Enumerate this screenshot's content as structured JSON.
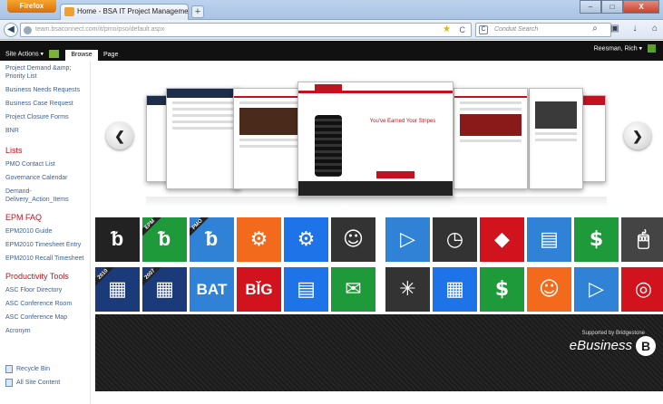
{
  "browser": {
    "menu_button": "Firefox",
    "tab_title": "Home - BSA IT Project Management Off...",
    "new_tab": "+",
    "window_min": "–",
    "window_max": "□",
    "window_close": "X",
    "url": "team.bsaconnect.com/it/pmo/pso/default.aspx",
    "search_placeholder": "Conduit Search",
    "search_engine_label": "C"
  },
  "ribbon": {
    "site_actions": "Site Actions ▾",
    "tabs": [
      "Browse",
      "Page"
    ],
    "user": "Reesman, Rich ▾"
  },
  "leftnav": {
    "items_top": [
      "Project Demand &amp; Priority List",
      "Business Needs Requests",
      "Business Case Request",
      "Project Closure Forms",
      "BNR"
    ],
    "lists_heading": "Lists",
    "lists_items": [
      "PMO Contact List",
      "Governance Calendar",
      "Demand-Delivery_Action_Items"
    ],
    "epm_heading": "EPM FAQ",
    "epm_items": [
      "EPM2010 Guide",
      "EPM2010 Timesheet Entry",
      "EPM2010 Recall Timesheet"
    ],
    "prod_heading": "Productivity Tools",
    "prod_items": [
      "ASC Floor Directory",
      "ASC Conference Room",
      "ASC Conference Map",
      "Acronym"
    ],
    "bottom_items": [
      "Recycle Bin",
      "All Site Content"
    ]
  },
  "carousel": {
    "prev": "❮",
    "next": "❯",
    "center_headline": "You've Earned Your Stripes",
    "colors": {
      "accent_red": "#c1121f",
      "nav_blue": "#1d2d4a"
    }
  },
  "tiles": [
    {
      "icon": "rss-icon",
      "glyph": "ᵬ",
      "color": "#222222",
      "label": ""
    },
    {
      "icon": "epm-icon",
      "glyph": "ᵬ",
      "color": "#1f9a3a",
      "label": "EPM"
    },
    {
      "icon": "pmo-icon",
      "glyph": "ᵬ",
      "color": "#2f82d6",
      "label": "PMO"
    },
    {
      "icon": "settings-window-icon",
      "glyph": "⚙",
      "color": "#f46a1c",
      "label": ""
    },
    {
      "icon": "gears-icon",
      "glyph": "⚙",
      "color": "#1e73e8",
      "label": ""
    },
    {
      "icon": "people-icon",
      "glyph": "☺",
      "color": "#333333",
      "label": ""
    },
    {
      "icon": "play-icon",
      "glyph": "▷",
      "color": "#2f82d6",
      "label": ""
    },
    {
      "icon": "clock-icon",
      "glyph": "◷",
      "color": "#333333",
      "label": ""
    },
    {
      "icon": "tag-icon",
      "glyph": "◆",
      "color": "#d0131d",
      "label": ""
    },
    {
      "icon": "document-icon",
      "glyph": "▤",
      "color": "#2f82d6",
      "label": ""
    },
    {
      "icon": "dollar-icon",
      "glyph": "$",
      "color": "#1f9a3a",
      "label": ""
    },
    {
      "icon": "mouse-icon",
      "glyph": "🖱",
      "color": "#444444",
      "label": ""
    },
    {
      "icon": "calendar-2010-icon",
      "glyph": "▦",
      "color": "#1a3a7a",
      "label": "2010"
    },
    {
      "icon": "archive-2007-icon",
      "glyph": "▦",
      "color": "#1a3a7a",
      "label": "2007"
    },
    {
      "icon": "bat-icon",
      "glyph": "BAT",
      "color": "#2f82d6",
      "label": ""
    },
    {
      "icon": "big-icon",
      "glyph": "BǏG",
      "color": "#d0131d",
      "label": ""
    },
    {
      "icon": "form-icon",
      "glyph": "▤",
      "color": "#1e73e8",
      "label": ""
    },
    {
      "icon": "chat-icon",
      "glyph": "✉",
      "color": "#1f9a3a",
      "label": ""
    },
    {
      "icon": "network-icon",
      "glyph": "✳",
      "color": "#333333",
      "label": ""
    },
    {
      "icon": "calendar-icon",
      "glyph": "▦",
      "color": "#1e73e8",
      "label": ""
    },
    {
      "icon": "dollar-icon",
      "glyph": "$",
      "color": "#1f9a3a",
      "label": ""
    },
    {
      "icon": "meeting-icon",
      "glyph": "☺",
      "color": "#f46a1c",
      "label": ""
    },
    {
      "icon": "play-icon",
      "glyph": "▷",
      "color": "#2f82d6",
      "label": ""
    },
    {
      "icon": "lifebuoy-icon",
      "glyph": "◎",
      "color": "#d0131d",
      "label": ""
    }
  ],
  "banner": {
    "supported_by": "Supported by Bridgestone",
    "ebusiness": "eBusiness",
    "logo_letter": "B"
  }
}
